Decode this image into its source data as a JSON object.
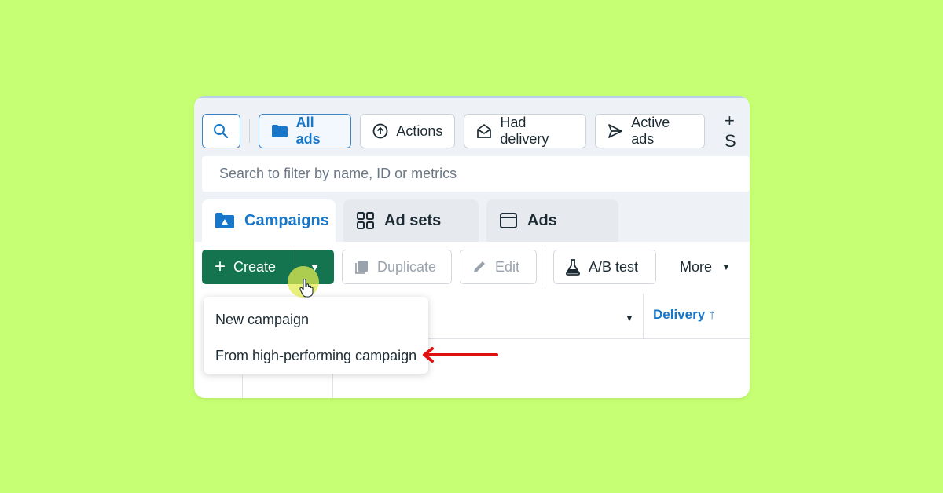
{
  "filters": {
    "all_ads": "All ads",
    "actions": "Actions",
    "had_delivery": "Had delivery",
    "active_ads": "Active ads",
    "more_symbol": "+ S"
  },
  "search": {
    "placeholder": "Search to filter by name, ID or metrics"
  },
  "tabs": [
    {
      "label": "Campaigns",
      "active": true
    },
    {
      "label": "Ad sets",
      "active": false
    },
    {
      "label": "Ads",
      "active": false
    }
  ],
  "toolbar": {
    "create": "Create",
    "duplicate": "Duplicate",
    "edit": "Edit",
    "ab_test": "A/B test",
    "more": "More"
  },
  "table": {
    "delivery_header": "Delivery"
  },
  "menu": {
    "items": [
      "New campaign",
      "From high-performing campaign"
    ]
  },
  "colors": {
    "background": "#c6ff73",
    "primary_green": "#13744f",
    "accent_blue": "#1877c9",
    "arrow_red": "#e01010"
  }
}
